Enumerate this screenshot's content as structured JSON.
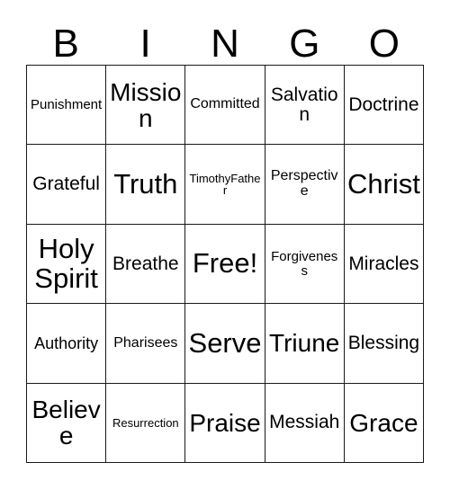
{
  "card": {
    "header_letters": [
      "B",
      "I",
      "N",
      "G",
      "O"
    ],
    "free_space_label": "Free!",
    "rows": [
      [
        {
          "text": "Punishment",
          "size": "fs-xs"
        },
        {
          "text": "Mission",
          "size": "fs-xxl"
        },
        {
          "text": "Committed",
          "size": "fs-s"
        },
        {
          "text": "Salvation",
          "size": "fs-l"
        },
        {
          "text": "Doctrine",
          "size": "fs-l"
        }
      ],
      [
        {
          "text": "Grateful",
          "size": "fs-l"
        },
        {
          "text": "Truth",
          "size": "fs-3xl"
        },
        {
          "text": "TimothyFather",
          "size": "fs-xxs"
        },
        {
          "text": "Perspective",
          "size": "fs-s"
        },
        {
          "text": "Christ",
          "size": "fs-3xl"
        }
      ],
      [
        {
          "text": "Holy Spirit",
          "size": "fs-3xl"
        },
        {
          "text": "Breathe",
          "size": "fs-l"
        },
        {
          "text": "Free!",
          "size": "fs-3xl"
        },
        {
          "text": "Forgiveness",
          "size": "fs-xs"
        },
        {
          "text": "Miracles",
          "size": "fs-l"
        }
      ],
      [
        {
          "text": "Authority",
          "size": "fs-m"
        },
        {
          "text": "Pharisees",
          "size": "fs-s"
        },
        {
          "text": "Serve",
          "size": "fs-3xl"
        },
        {
          "text": "Triune",
          "size": "fs-xxl"
        },
        {
          "text": "Blessing",
          "size": "fs-l"
        }
      ],
      [
        {
          "text": "Believe",
          "size": "fs-xxl"
        },
        {
          "text": "Resurrection",
          "size": "fs-xxs"
        },
        {
          "text": "Praise",
          "size": "fs-xxl"
        },
        {
          "text": "Messiah",
          "size": "fs-l"
        },
        {
          "text": "Grace",
          "size": "fs-xxl"
        }
      ]
    ]
  },
  "colors": {
    "background": "#ffffff",
    "border": "#1a1a1a",
    "text": "#000000"
  }
}
